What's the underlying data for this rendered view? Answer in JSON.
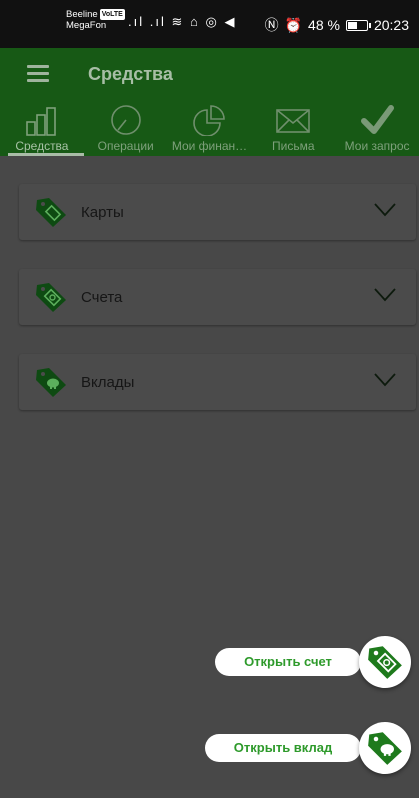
{
  "status_bar": {
    "carrier_1": "Beeline",
    "carrier_1_badge": "VoLTE",
    "carrier_2": "MegaFon",
    "battery": "48 %",
    "time": "20:23"
  },
  "app_bar": {
    "title": "Средства"
  },
  "tabs": [
    {
      "label": "Средства",
      "icon": "bar-chart-icon",
      "active": true
    },
    {
      "label": "Операции",
      "icon": "clock-icon",
      "active": false
    },
    {
      "label": "Мои финан…",
      "icon": "pie-chart-icon",
      "active": false
    },
    {
      "label": "Письма",
      "icon": "envelope-icon",
      "active": false
    },
    {
      "label": "Мои запрос",
      "icon": "checkmark-icon",
      "active": false
    }
  ],
  "sections": [
    {
      "label": "Карты",
      "icon": "card-tag-icon"
    },
    {
      "label": "Счета",
      "icon": "money-tag-icon"
    },
    {
      "label": "Вклады",
      "icon": "piggy-tag-icon"
    }
  ],
  "fabs": {
    "open_account": "Открыть счет",
    "open_deposit": "Открыть вклад"
  },
  "colors": {
    "brand_green": "#1e7a1c",
    "fab_text_green": "#2e9a2b"
  }
}
